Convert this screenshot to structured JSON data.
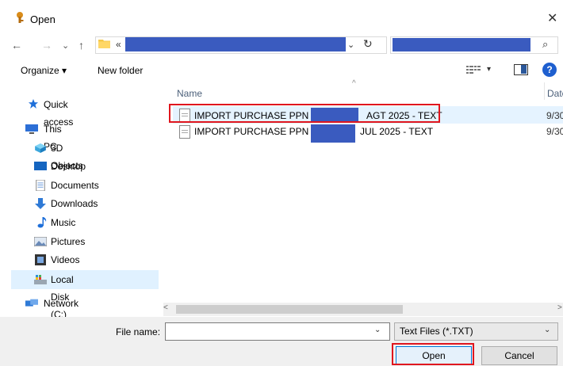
{
  "window": {
    "title": "Open",
    "close_glyph": "✕"
  },
  "nav_buttons": {
    "back": "←",
    "forward": "→",
    "recent": "⌄",
    "up": "↑"
  },
  "address": {
    "breadcrumb": "«",
    "dropdown": "⌄",
    "refresh": "↻"
  },
  "search": {
    "icon": "⌕"
  },
  "toolbar": {
    "organize_label": "Organize ▾",
    "new_folder_label": "New folder",
    "view_options_chevron": "▾",
    "help_label": "?"
  },
  "nav_pane": {
    "items": [
      {
        "label": "Quick access",
        "icon": "star-icon"
      },
      {
        "label": "This PC",
        "icon": "computer-icon"
      },
      {
        "label": "3D Objects",
        "icon": "cube-icon"
      },
      {
        "label": "Desktop",
        "icon": "desktop-icon"
      },
      {
        "label": "Documents",
        "icon": "documents-icon"
      },
      {
        "label": "Downloads",
        "icon": "download-icon"
      },
      {
        "label": "Music",
        "icon": "music-icon"
      },
      {
        "label": "Pictures",
        "icon": "pictures-icon"
      },
      {
        "label": "Videos",
        "icon": "videos-icon"
      },
      {
        "label": "Local Disk (C:)",
        "icon": "drive-icon"
      },
      {
        "label": "Network",
        "icon": "network-icon"
      }
    ],
    "selected": "Local Disk (C:)"
  },
  "file_list": {
    "columns": {
      "name": "Name",
      "date": "Date",
      "sort_arrow": "^"
    },
    "files": [
      {
        "name_prefix": "IMPORT PURCHASE PPN -",
        "name_suffix": "AGT 2025 - TEXT",
        "date": "9/30",
        "highlighted": true
      },
      {
        "name_prefix": "IMPORT PURCHASE PPN -",
        "name_suffix": "JUL 2025 - TEXT",
        "date": "9/30",
        "highlighted": false
      }
    ]
  },
  "scrollbar": {
    "left": "<",
    "right": ">"
  },
  "bottom": {
    "file_name_label": "File name:",
    "file_name_value": "",
    "file_name_chevron": "⌄",
    "file_type_value": "Text Files (*.TXT)",
    "file_type_chevron": "⌄",
    "open_label": "Open",
    "cancel_label": "Cancel"
  },
  "colors": {
    "accent": "#0078d7",
    "redaction": "#3a5bbf",
    "annotation": "#e0161e",
    "selection": "#cce8ff"
  }
}
